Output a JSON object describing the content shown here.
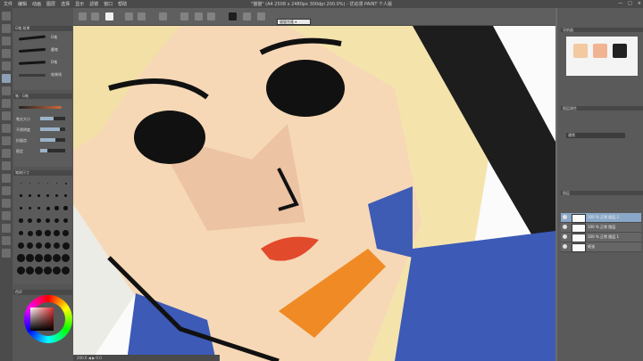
{
  "window": {
    "title": "\"猫猫\" (A4 2508 x 2480px 300dpi 200.0%) - 优动漫 PAINT 个人版",
    "menu": [
      "文件",
      "编辑",
      "动画",
      "图层",
      "选择",
      "显示",
      "滤镜",
      "窗口",
      "帮助"
    ],
    "controls": [
      "—",
      "□",
      "×"
    ]
  },
  "toolbar": {
    "search_label": "猫猫克隆 ▾"
  },
  "left_panel": {
    "subtool_tabs": [
      "G笔",
      "效果"
    ],
    "subtool_items": [
      "G笔",
      "圆笔",
      "D笔",
      "效果线"
    ],
    "tool_property": {
      "header": "笔 · G笔",
      "rows": [
        "笔尖大小",
        "不透明度",
        "抗锯齿",
        "稳定"
      ],
      "fills": [
        0.55,
        0.8,
        0.6,
        0.3
      ]
    },
    "brush_size_header": "笔刷尺寸",
    "color_header": "色环"
  },
  "right_panel": {
    "navigator_header": "导航器",
    "layer_property_header": "图层属性",
    "blend_label": "通常",
    "layer_header": "图层",
    "layers": [
      {
        "name": "100 % 正常\n图层 2",
        "selected": true
      },
      {
        "name": "100 % 正常 图层",
        "selected": false
      },
      {
        "name": "100 % 正常\n图层 1",
        "selected": false
      },
      {
        "name": "纸张",
        "selected": false
      }
    ]
  },
  "status": {
    "text": "200.0  ◀ ▶  0.0"
  },
  "colors": {
    "accent": "#8aa8c8",
    "skin": "#f5d6b4",
    "hair": "#f4e2a8",
    "clothing": "#4a66b8",
    "orange": "#f08a24"
  }
}
